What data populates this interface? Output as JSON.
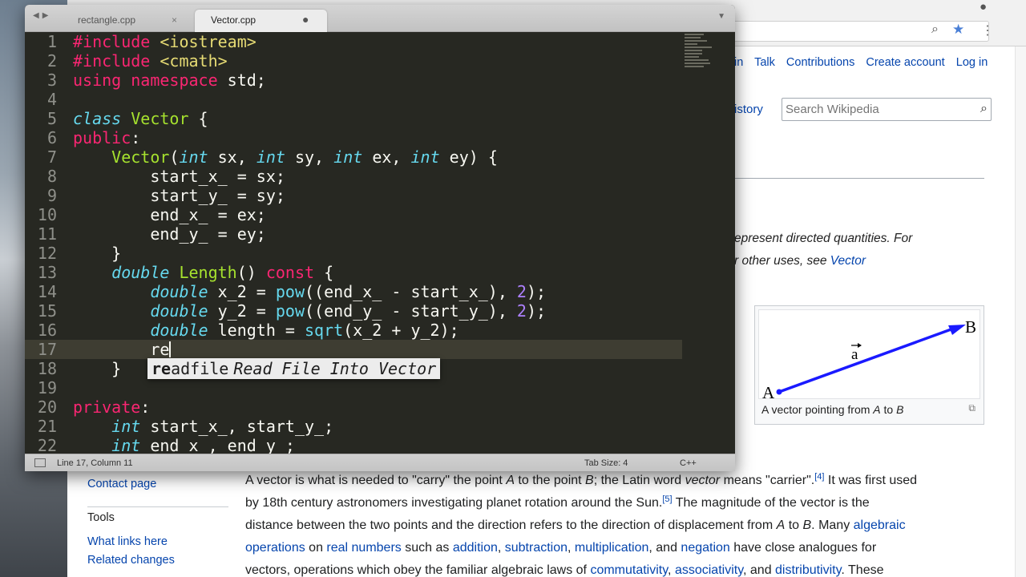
{
  "editor": {
    "tabs": [
      {
        "label": "rectangle.cpp",
        "state": "×"
      },
      {
        "label": "Vector.cpp",
        "state": "●"
      }
    ],
    "code_lines": [
      {
        "n": "1",
        "tokens": [
          {
            "t": "#include <iostream>",
            "c": "kw"
          }
        ]
      },
      {
        "n": "2",
        "tokens": [
          {
            "t": "#include <cmath>",
            "c": "kw"
          }
        ]
      },
      {
        "n": "3",
        "tokens": [
          {
            "t": "using namespace ",
            "c": "kw"
          },
          {
            "t": "std;",
            "c": "pl"
          }
        ]
      },
      {
        "n": "4",
        "tokens": []
      },
      {
        "n": "5",
        "tokens": [
          {
            "t": "class ",
            "c": "type"
          },
          {
            "t": "Vector",
            "c": "fn"
          },
          {
            "t": " {",
            "c": "pl"
          }
        ]
      },
      {
        "n": "6",
        "tokens": [
          {
            "t": "public",
            "c": "kw"
          },
          {
            "t": ":",
            "c": "pl"
          }
        ]
      },
      {
        "n": "7",
        "tokens": [
          {
            "t": "    ",
            "c": "pl"
          },
          {
            "t": "Vector",
            "c": "fn"
          },
          {
            "t": "(",
            "c": "pl"
          },
          {
            "t": "int",
            "c": "type"
          },
          {
            "t": " sx, ",
            "c": "pl"
          },
          {
            "t": "int",
            "c": "type"
          },
          {
            "t": " sy, ",
            "c": "pl"
          },
          {
            "t": "int",
            "c": "type"
          },
          {
            "t": " ex, ",
            "c": "pl"
          },
          {
            "t": "int",
            "c": "type"
          },
          {
            "t": " ey) {",
            "c": "pl"
          }
        ]
      },
      {
        "n": "8",
        "tokens": [
          {
            "t": "        start_x_ = sx;",
            "c": "pl"
          }
        ]
      },
      {
        "n": "9",
        "tokens": [
          {
            "t": "        start_y_ = sy;",
            "c": "pl"
          }
        ]
      },
      {
        "n": "10",
        "tokens": [
          {
            "t": "        end_x_ = ex;",
            "c": "pl"
          }
        ]
      },
      {
        "n": "11",
        "tokens": [
          {
            "t": "        end_y_ = ey;",
            "c": "pl"
          }
        ]
      },
      {
        "n": "12",
        "tokens": [
          {
            "t": "    }",
            "c": "pl"
          }
        ]
      },
      {
        "n": "13",
        "tokens": [
          {
            "t": "    ",
            "c": "pl"
          },
          {
            "t": "double",
            "c": "type"
          },
          {
            "t": " ",
            "c": "pl"
          },
          {
            "t": "Length",
            "c": "fn"
          },
          {
            "t": "() ",
            "c": "pl"
          },
          {
            "t": "const",
            "c": "kw"
          },
          {
            "t": " {",
            "c": "pl"
          }
        ]
      },
      {
        "n": "14",
        "tokens": [
          {
            "t": "        ",
            "c": "pl"
          },
          {
            "t": "double",
            "c": "type"
          },
          {
            "t": " x_2 = ",
            "c": "pl"
          },
          {
            "t": "pow",
            "c": "call"
          },
          {
            "t": "((end_x_ - start_x_), ",
            "c": "pl"
          },
          {
            "t": "2",
            "c": "num"
          },
          {
            "t": ");",
            "c": "pl"
          }
        ]
      },
      {
        "n": "15",
        "tokens": [
          {
            "t": "        ",
            "c": "pl"
          },
          {
            "t": "double",
            "c": "type"
          },
          {
            "t": " y_2 = ",
            "c": "pl"
          },
          {
            "t": "pow",
            "c": "call"
          },
          {
            "t": "((end_y_ - start_y_), ",
            "c": "pl"
          },
          {
            "t": "2",
            "c": "num"
          },
          {
            "t": ");",
            "c": "pl"
          }
        ]
      },
      {
        "n": "16",
        "tokens": [
          {
            "t": "        ",
            "c": "pl"
          },
          {
            "t": "double",
            "c": "type"
          },
          {
            "t": " length = ",
            "c": "pl"
          },
          {
            "t": "sqrt",
            "c": "call"
          },
          {
            "t": "(x_2 + y_2);",
            "c": "pl"
          }
        ]
      },
      {
        "n": "17",
        "tokens": [
          {
            "t": "        re",
            "c": "pl"
          }
        ],
        "current": true
      },
      {
        "n": "18",
        "tokens": [
          {
            "t": "    }",
            "c": "pl"
          }
        ]
      },
      {
        "n": "19",
        "tokens": []
      },
      {
        "n": "20",
        "tokens": [
          {
            "t": "private",
            "c": "kw"
          },
          {
            "t": ":",
            "c": "pl"
          }
        ]
      },
      {
        "n": "21",
        "tokens": [
          {
            "t": "    ",
            "c": "pl"
          },
          {
            "t": "int",
            "c": "type"
          },
          {
            "t": " start_x_, start_y_;",
            "c": "pl"
          }
        ]
      },
      {
        "n": "22",
        "tokens": [
          {
            "t": "    ",
            "c": "pl"
          },
          {
            "t": "int",
            "c": "type"
          },
          {
            "t": " end_x_, end_y_;",
            "c": "pl"
          }
        ]
      }
    ],
    "autocomplete": {
      "match": "re",
      "rest": "adfile",
      "hint": "Read File Into Vector"
    },
    "status": {
      "position": "Line 17, Column 11",
      "tab_size": "Tab Size: 4",
      "syntax": "C++"
    },
    "colors": {
      "kw": "#f92672",
      "type": "#66d9ef",
      "fn": "#a6e22e",
      "call": "#66d9ef",
      "num": "#ae81ff",
      "pl": "#f8f8f2"
    },
    "icons": {
      "nav": "back-forward-arrows",
      "dropdown": "chevron-down-icon",
      "panel": "panel-toggle-icon"
    }
  },
  "browser": {
    "personal_nav": [
      "in",
      "Talk",
      "Contributions",
      "Create account",
      "Log in"
    ],
    "history_tab": "istory",
    "search_placeholder": "Search Wikipedia",
    "hatnote": {
      "line1": "epresent directed quantities. For",
      "line2_pre": "r other uses, see ",
      "line2_link": "Vector"
    },
    "infobox": {
      "label_a": "A",
      "label_b": "B",
      "label_vec": "a",
      "caption_pre": "A vector pointing from ",
      "caption_a": "A",
      "caption_mid": " to ",
      "caption_b": "B"
    },
    "sidebar": {
      "contact": "Contact page",
      "tools": "Tools",
      "what_links": "What links here",
      "related": "Related changes"
    },
    "article": {
      "l1_a": "A vector is what is needed to \"carry\" the point ",
      "l1_A": "A",
      "l1_b": " to the point ",
      "l1_B": "B",
      "l1_c": "; the Latin word ",
      "l1_vector": "vector",
      "l1_d": " means \"carrier\".",
      "l1_ref": "[4]",
      "l1_e": " It was first used",
      "l2_a": "by 18th century astronomers investigating planet rotation around the Sun.",
      "l2_ref": "[5]",
      "l2_b": " The magnitude of the vector is the",
      "l3_a": "distance between the two points and the direction refers to the direction of displacement from ",
      "l3_A": "A",
      "l3_b": " to ",
      "l3_B": "B",
      "l3_c": ". Many ",
      "l3_link": "algebraic",
      "l4_link1": "operations",
      "l4_a": " on ",
      "l4_link2": "real numbers",
      "l4_b": " such as ",
      "l4_link3": "addition",
      "l4_c": ", ",
      "l4_link4": "subtraction",
      "l4_d": ", ",
      "l4_link5": "multiplication",
      "l4_e": ", and ",
      "l4_link6": "negation",
      "l4_f": " have close analogues for",
      "l5_a": "vectors, operations which obey the familiar algebraic laws of ",
      "l5_link1": "commutativity",
      "l5_b": ", ",
      "l5_link2": "associativity",
      "l5_c": ", and ",
      "l5_link3": "distributivity",
      "l5_d": ". These"
    }
  }
}
